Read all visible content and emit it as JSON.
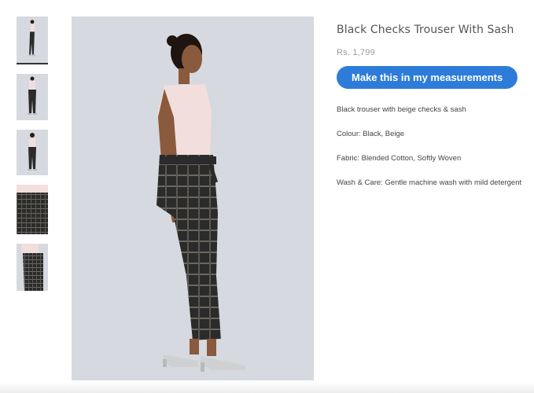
{
  "product": {
    "title": "Black Checks Trouser With Sash",
    "price": "Rs. 1,799",
    "cta_label": "Make this in my measurements",
    "description": "Black trouser with beige checks & sash",
    "colour": "Colour: Black, Beige",
    "fabric": "Fabric: Blended Cotton, Softly Woven",
    "care": "Wash & Care: Gentle machine wash with mild detergent"
  },
  "gallery": {
    "thumbnail_count": 5,
    "active_index": 0,
    "thumbnails": [
      "side-view",
      "front-view",
      "back-view",
      "fabric-closeup",
      "side-closeup"
    ],
    "main_image": "model-side-view"
  },
  "colors": {
    "accent": "#2d7cd9",
    "photo_bg": "#d6d9df",
    "trouser": "#2b2b2b",
    "top": "#f3dede"
  }
}
